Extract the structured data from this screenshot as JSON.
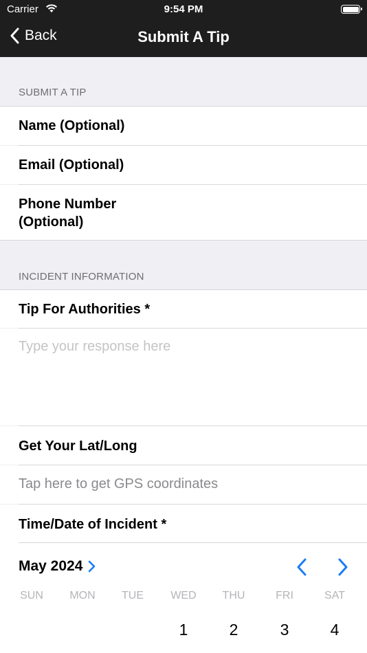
{
  "status_bar": {
    "carrier": "Carrier",
    "time": "9:54 PM"
  },
  "nav": {
    "back_label": "Back",
    "title": "Submit A Tip"
  },
  "submit_section": {
    "header": "SUBMIT A TIP",
    "fields": [
      {
        "label": "Name (Optional)"
      },
      {
        "label": "Email (Optional)"
      },
      {
        "label_line1": "Phone Number",
        "label_line2": "(Optional)"
      }
    ]
  },
  "incident_section": {
    "header": "INCIDENT INFORMATION",
    "tip_label": "Tip For Authorities *",
    "tip_placeholder": "Type your response here",
    "latlong_label": "Get Your Lat/Long",
    "gps_hint": "Tap here to get GPS coordinates",
    "datetime_label": "Time/Date of Incident *"
  },
  "calendar": {
    "month_year": "May 2024",
    "weekdays": [
      "SUN",
      "MON",
      "TUE",
      "WED",
      "THU",
      "FRI",
      "SAT"
    ],
    "visible_days": [
      "1",
      "2",
      "3",
      "4"
    ],
    "accent_color": "#1a7cf5"
  }
}
